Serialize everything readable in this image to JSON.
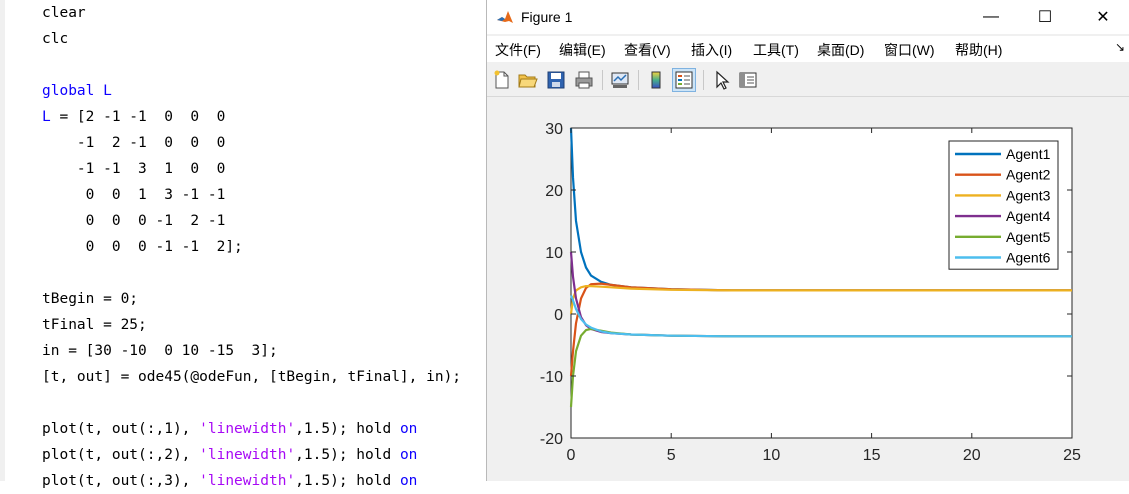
{
  "editor": {
    "lines": [
      {
        "text": "clear"
      },
      {
        "text": "clc"
      },
      {
        "text": ""
      },
      {
        "kw": "global",
        "text": " L"
      },
      {
        "text": "L = [2 -1 -1  0  0  0"
      },
      {
        "text": "    -1  2 -1  0  0  0"
      },
      {
        "text": "    -1 -1  3  1  0  0"
      },
      {
        "text": "     0  0  1  3 -1 -1"
      },
      {
        "text": "     0  0  0 -1  2 -1"
      },
      {
        "text": "     0  0  0 -1 -1  2];"
      },
      {
        "text": ""
      },
      {
        "text": "tBegin = 0;"
      },
      {
        "text": "tFinal = 25;"
      },
      {
        "text": "in = [30 -10  0 10 -15  3];"
      },
      {
        "text": "[t, out] = ode45(@odeFun, [tBegin, tFinal], in);"
      },
      {
        "text": ""
      },
      {
        "text": "plot(t, out(:,1), ",
        "str": "'linewidth'",
        "tail": ",1.5); hold ",
        "kw2": "on"
      },
      {
        "text": "plot(t, out(:,2), ",
        "str": "'linewidth'",
        "tail": ",1.5); hold ",
        "kw2": "on"
      },
      {
        "text": "plot(t, out(:,3), ",
        "str": "'linewidth'",
        "tail": ",1.5); hold ",
        "kw2": "on"
      }
    ]
  },
  "figure": {
    "title": "Figure 1",
    "window_buttons": {
      "minimize": "—",
      "maximize": "☐",
      "close": "✕"
    },
    "menu": [
      "文件(F)",
      "编辑(E)",
      "查看(V)",
      "插入(I)",
      "工具(T)",
      "桌面(D)",
      "窗口(W)",
      "帮助(H)"
    ],
    "menu_overflow": "↘",
    "toolbar_icons": [
      "new-figure-icon",
      "open-file-icon",
      "save-icon",
      "print-icon",
      "link-plot-icon",
      "colorbar-icon",
      "legend-icon",
      "pointer-icon",
      "property-inspector-icon"
    ]
  },
  "chart_data": {
    "type": "line",
    "xlim": [
      0,
      25
    ],
    "ylim": [
      -20,
      30
    ],
    "xticks": [
      "0",
      "5",
      "10",
      "15",
      "20",
      "25"
    ],
    "yticks": [
      "30",
      "20",
      "10",
      "0",
      "-10",
      "-20"
    ],
    "legend_position": "top-right",
    "grid": false,
    "series": [
      {
        "name": "Agent1",
        "color": "#0072bd",
        "x": [
          0,
          0.1,
          0.25,
          0.5,
          0.75,
          1,
          1.5,
          2,
          3,
          5,
          8,
          25
        ],
        "y": [
          30,
          22,
          15,
          10,
          7.5,
          6.2,
          5.2,
          4.7,
          4.3,
          4.0,
          3.8,
          3.8
        ]
      },
      {
        "name": "Agent2",
        "color": "#d95319",
        "x": [
          0,
          0.1,
          0.25,
          0.5,
          0.75,
          1,
          1.5,
          2,
          3,
          5,
          8,
          25
        ],
        "y": [
          -10,
          -6,
          -1.5,
          2.5,
          4.2,
          4.8,
          4.9,
          4.7,
          4.3,
          4.0,
          3.8,
          3.8
        ]
      },
      {
        "name": "Agent3",
        "color": "#edb120",
        "x": [
          0,
          0.1,
          0.25,
          0.5,
          0.75,
          1,
          1.5,
          2,
          3,
          5,
          8,
          25
        ],
        "y": [
          0,
          2.5,
          3.8,
          4.3,
          4.5,
          4.5,
          4.4,
          4.3,
          4.1,
          3.9,
          3.8,
          3.8
        ]
      },
      {
        "name": "Agent4",
        "color": "#7e2f8e",
        "x": [
          0,
          0.1,
          0.25,
          0.5,
          0.75,
          1,
          1.5,
          2,
          3,
          5,
          8,
          25
        ],
        "y": [
          10,
          6,
          2.5,
          -0.5,
          -1.8,
          -2.4,
          -2.9,
          -3.1,
          -3.3,
          -3.5,
          -3.6,
          -3.6
        ]
      },
      {
        "name": "Agent5",
        "color": "#77ac30",
        "x": [
          0,
          0.1,
          0.25,
          0.5,
          0.75,
          1,
          1.5,
          2,
          3,
          5,
          8,
          25
        ],
        "y": [
          -15,
          -10,
          -6,
          -3.5,
          -2.6,
          -2.4,
          -2.7,
          -3.0,
          -3.3,
          -3.5,
          -3.6,
          -3.6
        ]
      },
      {
        "name": "Agent6",
        "color": "#4dbeee",
        "x": [
          0,
          0.1,
          0.25,
          0.5,
          0.75,
          1,
          1.5,
          2,
          3,
          5,
          8,
          25
        ],
        "y": [
          3,
          2.2,
          0.8,
          -0.8,
          -1.7,
          -2.2,
          -2.8,
          -3.1,
          -3.3,
          -3.5,
          -3.6,
          -3.6
        ]
      }
    ]
  }
}
